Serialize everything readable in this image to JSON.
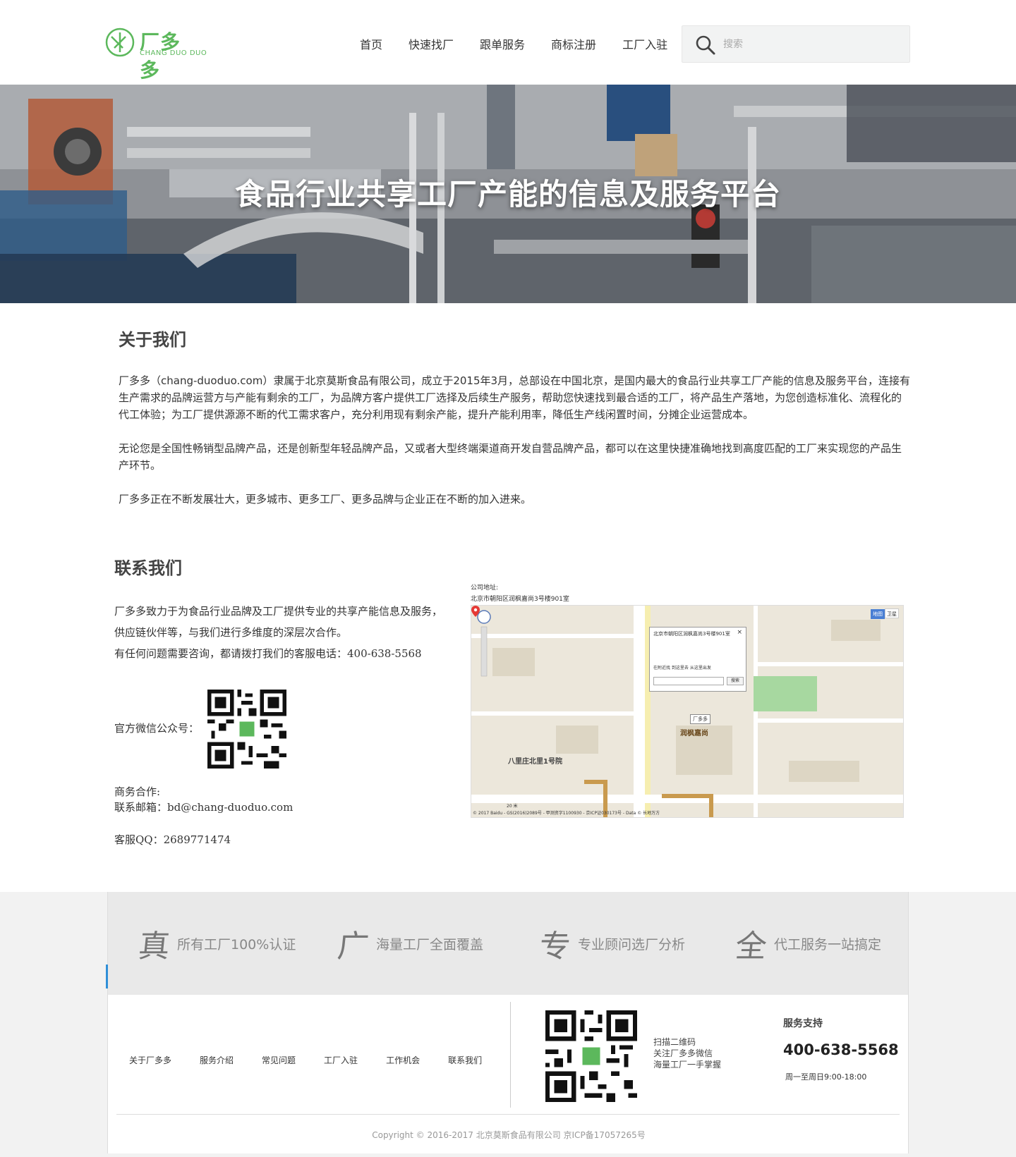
{
  "header": {
    "logo_cn": "厂多多",
    "logo_en": "CHANG DUO DUO",
    "nav": [
      "首页",
      "快速找厂",
      "跟单服务",
      "商标注册",
      "工厂入驻"
    ],
    "search_placeholder": "搜索"
  },
  "banner": {
    "title": "食品行业共享工厂产能的信息及服务平台"
  },
  "about": {
    "title": "关于我们",
    "p1": "厂多多（chang-duoduo.com）隶属于北京莫斯食品有限公司，成立于2015年3月，总部设在中国北京，是国内最大的食品行业共享工厂产能的信息及服务平台，连接有生产需求的品牌运营方与产能有剩余的工厂，为品牌方客户提供工厂选择及后续生产服务，帮助您快速找到最合适的工厂，将产品生产落地，为您创造标准化、流程化的代工体验；为工厂提供源源不断的代工需求客户，充分利用现有剩余产能，提升产能利用率，降低生产线闲置时间，分摊企业运营成本。",
    "p2": "无论您是全国性畅销型品牌产品，还是创新型年轻品牌产品，又或者大型终端渠道商开发自营品牌产品，都可以在这里快捷准确地找到高度匹配的工厂来实现您的产品生产环节。",
    "p3": "厂多多正在不断发展壮大，更多城市、更多工厂、更多品牌与企业正在不断的加入进来。"
  },
  "contact": {
    "title": "联系我们",
    "line1": "厂多多致力于为食品行业品牌及工厂提供专业的共享产能信息及服务，",
    "line2": "供应链伙伴等，与我们进行多维度的深层次合作。",
    "line3": "有任何问题需要咨询，都请拨打我们的客服电话：400-638-5568",
    "wechat_label": "官方微信公众号：",
    "biz_label": "商务合作:",
    "email": "联系邮箱：bd@chang-duoduo.com",
    "qq": "客服QQ：2689771474",
    "map_label_1": "公司地址:",
    "map_label_2": "北京市朝阳区润枫嘉尚3号楼901室",
    "map_popup_title": "北京市朝阳区润枫嘉尚3号楼901室",
    "map_popup_links": "在附近找   到这里去   从这里出发",
    "map_popup_button": "搜索",
    "map_toggle_1": "地图",
    "map_toggle_2": "卫星",
    "map_tag": "厂多多",
    "map_poi": "润枫嘉尚",
    "map_poi2": "八里庄北里1号院",
    "map_scale": "20 米",
    "map_copyright": "© 2017 Baidu - GS(2016)2089号 - 甲测资字1100930 - 京ICP证030173号 - Data © 长地万方"
  },
  "features": [
    {
      "char": "真",
      "text": "所有工厂100%认证"
    },
    {
      "char": "广",
      "text": "海量工厂全面覆盖"
    },
    {
      "char": "专",
      "text": "专业顾问选厂分析"
    },
    {
      "char": "全",
      "text": "代工服务一站搞定"
    }
  ],
  "footer": {
    "links": [
      "关于厂多多",
      "服务介绍",
      "常见问题",
      "工厂入驻",
      "工作机会",
      "联系我们"
    ],
    "scan_1": "扫描二维码",
    "scan_2": "关注厂多多微信",
    "scan_3": "海量工厂一手掌握",
    "service_title": "服务支持",
    "service_phone": "400-638-5568",
    "service_hours": "周一至周日9:00-18:00",
    "copyright": "Copyright © 2016-2017 北京莫斯食品有限公司 京ICP备17057265号"
  },
  "colors": {
    "brand_green": "#5cb85c",
    "accent_blue": "#2f8fd8"
  }
}
